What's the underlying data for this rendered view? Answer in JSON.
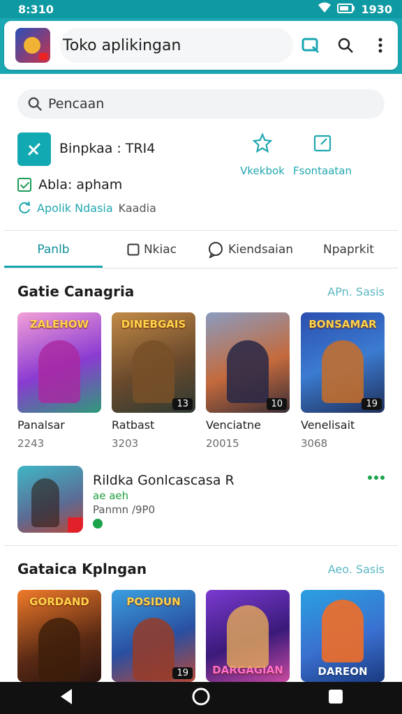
{
  "status_bar": {
    "time": "8:310",
    "clock_right": "1930"
  },
  "header": {
    "title": "Toko aplikingan"
  },
  "search": {
    "placeholder": "Pencaan"
  },
  "app_info": {
    "name": "Binpkaa : TRI4",
    "status": "Abla: apham",
    "developer": "Apolik Ndasia",
    "developer_extra": "Kaadia",
    "action_1": "Vkekbok",
    "action_2": "Fsontaatan"
  },
  "tabs": [
    {
      "label": "Panlb"
    },
    {
      "label": "Nkiac"
    },
    {
      "label": "Kiendsaian"
    },
    {
      "label": "Npaprkit"
    }
  ],
  "section_1": {
    "title": "Gatie Canagria",
    "link": "APn. Sasis",
    "cards": [
      {
        "caption": "ZALEHOW",
        "name": "Panalsar",
        "count": "2243",
        "badge": ""
      },
      {
        "caption": "DINEBGAIS",
        "name": "Ratbast",
        "count": "3203",
        "badge": "13"
      },
      {
        "caption": "",
        "name": "Venciatne",
        "count": "20015",
        "badge": "10"
      },
      {
        "caption": "BONSAMAR",
        "name": "Venelisait",
        "count": "3068",
        "badge": "19"
      }
    ]
  },
  "featured": {
    "title": "Rildka Gonlcascasa R",
    "subtitle": "ae aeh",
    "meta": "Panmn /9P0"
  },
  "section_2": {
    "title": "Gataica Kplngan",
    "link": "Aeo. Sasis",
    "cards": [
      {
        "caption": "GORDAND",
        "badge": ""
      },
      {
        "caption": "POSIDUN",
        "badge": "19"
      },
      {
        "caption": "DARGAGIAN",
        "badge": ""
      },
      {
        "caption": "DAREON",
        "badge": ""
      }
    ]
  },
  "colors": {
    "accent": "#18a5b0",
    "status_bar": "#0f9aa3",
    "green": "#1aa34a"
  }
}
